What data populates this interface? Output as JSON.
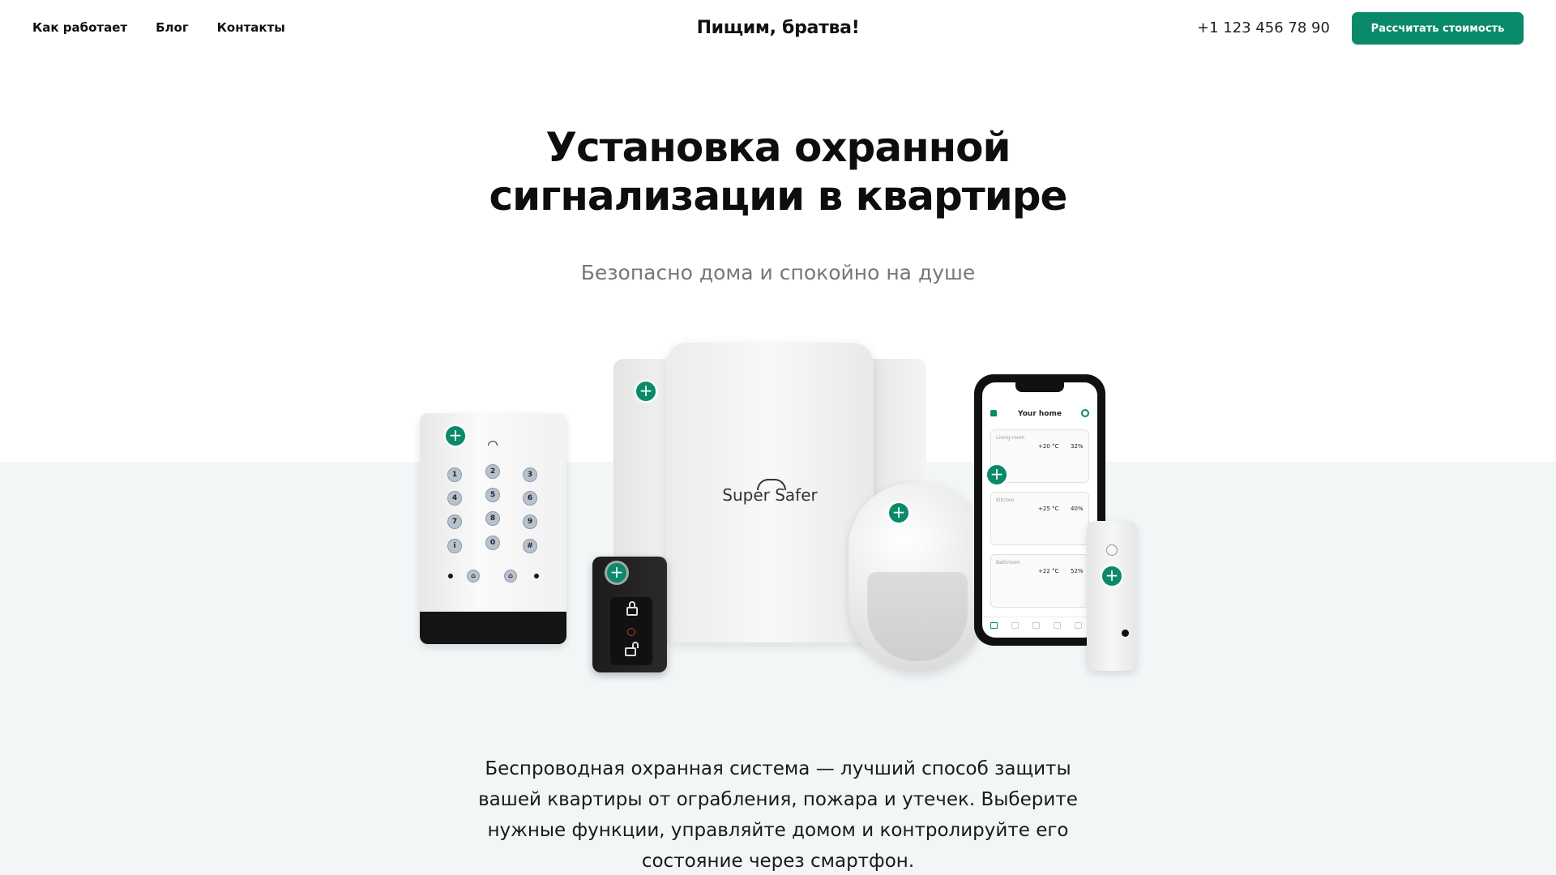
{
  "header": {
    "nav": [
      {
        "label": "Как работает"
      },
      {
        "label": "Блог"
      },
      {
        "label": "Контакты"
      }
    ],
    "logo": "Пищим, братва!",
    "phone": "+1 123 456 78 90",
    "cta_label": "Рассчитать стоимость"
  },
  "hero": {
    "title_line1": "Установка охранной",
    "title_line2": "сигнализации в квартире",
    "subtitle": "Безопасно дома и спокойно на душе"
  },
  "devices": {
    "keypad_keys": [
      "1",
      "2",
      "3",
      "4",
      "5",
      "6",
      "7",
      "8",
      "9",
      "i",
      "0",
      "#"
    ],
    "hub_brand": "Super Safer",
    "app": {
      "title": "Your home",
      "rooms": [
        {
          "name": "Living room",
          "temperature": "+20 °C",
          "humidity": "32%"
        },
        {
          "name": "Kitchen",
          "temperature": "+25 °C",
          "humidity": "40%"
        },
        {
          "name": "Bathroom",
          "temperature": "+22 °C",
          "humidity": "52%"
        }
      ]
    },
    "plus_icon": "+"
  },
  "description": "Беспроводная охранная система — лучший способ защиты вашей квартиры от ограбления, пожара и утечек. Выберите нужные функции, управляйте домом и контролируйте его состояние через смартфон.",
  "colors": {
    "accent": "#0a8a6a",
    "band": "#f2f6f7"
  }
}
